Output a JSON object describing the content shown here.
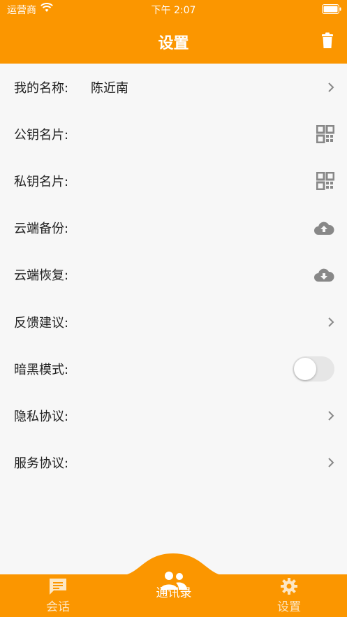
{
  "status_bar": {
    "carrier": "运营商",
    "time": "下午 2:07"
  },
  "header": {
    "title": "设置"
  },
  "settings": [
    {
      "label": "我的名称:",
      "value": "陈近南",
      "right_icon": "chevron-right-icon"
    },
    {
      "label": "公钥名片:",
      "value": "",
      "right_icon": "qr-code-icon"
    },
    {
      "label": "私钥名片:",
      "value": "",
      "right_icon": "qr-code-icon"
    },
    {
      "label": "云端备份:",
      "value": "",
      "right_icon": "cloud-upload-icon"
    },
    {
      "label": "云端恢复:",
      "value": "",
      "right_icon": "cloud-download-icon"
    },
    {
      "label": "反馈建议:",
      "value": "",
      "right_icon": "chevron-right-icon"
    },
    {
      "label": "暗黑模式:",
      "value": "",
      "right_icon": "toggle",
      "toggle_on": false
    },
    {
      "label": "隐私协议:",
      "value": "",
      "right_icon": "chevron-right-icon"
    },
    {
      "label": "服务协议:",
      "value": "",
      "right_icon": "chevron-right-icon"
    }
  ],
  "tabs": [
    {
      "label": "会话",
      "icon": "chat-icon",
      "active": false
    },
    {
      "label": "通讯录",
      "icon": "contacts-icon",
      "active": true
    },
    {
      "label": "设置",
      "icon": "gear-icon",
      "active": false
    }
  ],
  "colors": {
    "accent": "#fb9600",
    "icon_gray": "#888888",
    "background": "#f7f7f7"
  }
}
